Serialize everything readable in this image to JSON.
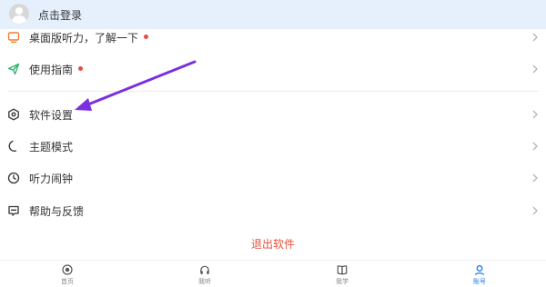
{
  "header": {
    "login_text": "点击登录"
  },
  "menu": {
    "items": [
      {
        "label": "桌面版听力，了解一下",
        "badge": true
      },
      {
        "label": "使用指南",
        "badge": true
      },
      {
        "label": "软件设置",
        "badge": false
      },
      {
        "label": "主题模式",
        "badge": false
      },
      {
        "label": "听力闹钟",
        "badge": false
      },
      {
        "label": "帮助与反馈",
        "badge": false
      }
    ]
  },
  "logout_label": "退出软件",
  "nav": {
    "items": [
      {
        "label": "首页",
        "active": false
      },
      {
        "label": "我听",
        "active": false
      },
      {
        "label": "我学",
        "active": false
      },
      {
        "label": "账号",
        "active": true
      }
    ]
  },
  "colors": {
    "header_bg": "#e6f0fc",
    "badge": "#e94b4b",
    "logout": "#e5533d",
    "active_nav": "#1e7bf0",
    "annotation_arrow": "#7b2fe0",
    "guide_icon": "#2bb36a",
    "desktop_icon": "#f07d2c"
  }
}
